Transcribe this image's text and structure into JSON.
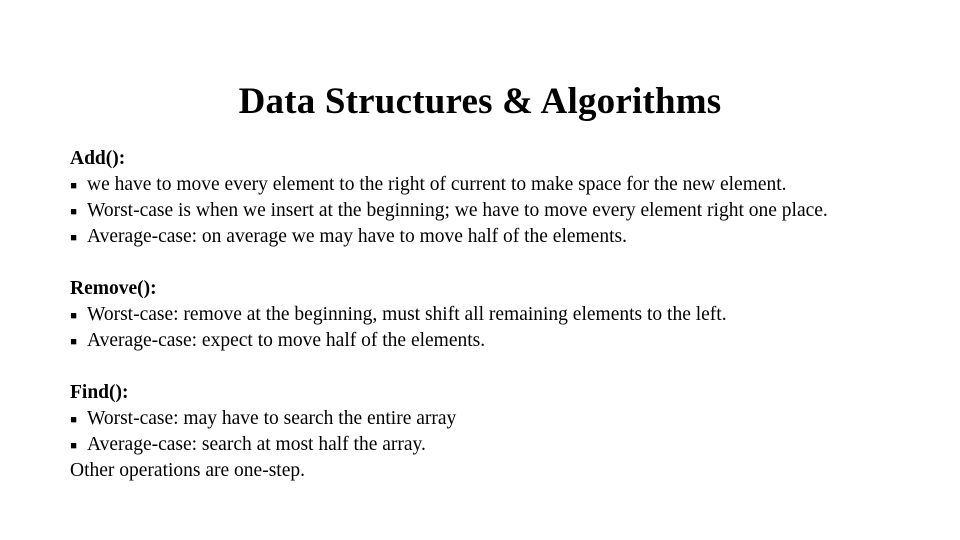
{
  "slide": {
    "title": "Data Structures & Algorithms",
    "bullet_glyph": "▪",
    "sections": [
      {
        "heading": "Add():",
        "bullets": [
          "we have to move every element to the right of  current to make space for the new element.",
          "Worst-case is when we insert at the beginning; we have to move every element right one place.",
          "Average-case: on average we may have to move half of the elements."
        ],
        "plain_lines": []
      },
      {
        "heading": "Remove():",
        "bullets": [
          "Worst-case: remove at the beginning, must shift all remaining elements to the left.",
          "Average-case: expect to move half of the elements."
        ],
        "plain_lines": []
      },
      {
        "heading": "Find():",
        "bullets": [
          "Worst-case: may have to search the entire array",
          "Average-case: search at most half the array."
        ],
        "plain_lines": [
          "Other operations are one-step."
        ]
      }
    ]
  },
  "colors": {
    "background": "#ffffff",
    "text": "#000000"
  }
}
